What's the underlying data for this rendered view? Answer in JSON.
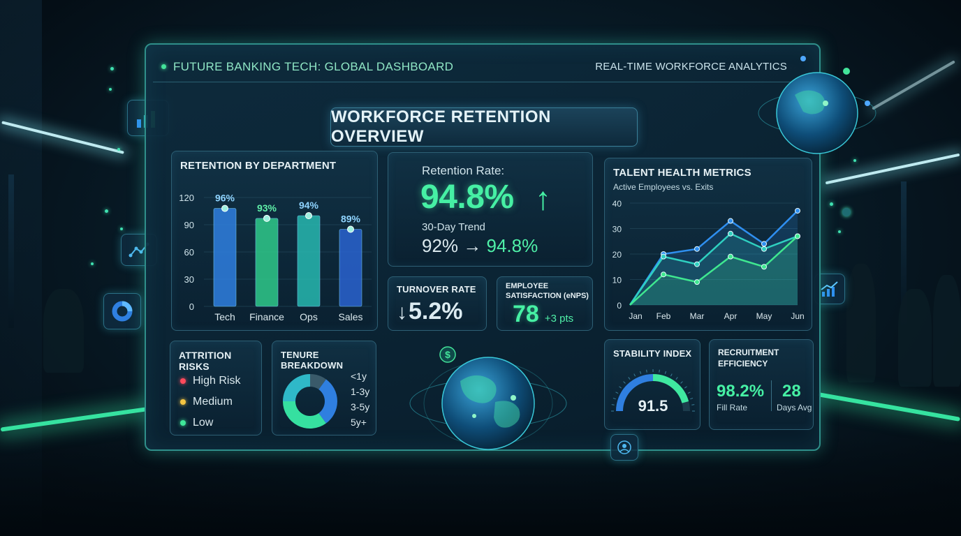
{
  "header": {
    "title": "FUTURE BANKING TECH: GLOBAL DASHBOARD",
    "subtitle": "REAL-TIME WORKFORCE ANALYTICS"
  },
  "main_title": "WORKFORCE RETENTION OVERVIEW",
  "retention_by_department": {
    "title": "RETENTION BY DEPARTMENT"
  },
  "retention_rate": {
    "label": "Retention Rate:",
    "value": "94.8%",
    "arrow": "↑",
    "trend_label": "30-Day Trend",
    "trend_from": "92%",
    "trend_arrow": "→",
    "trend_to": "94.8%"
  },
  "turnover": {
    "title": "TURNOVER RATE",
    "arrow": "↓",
    "value": "5.2%"
  },
  "satisfaction": {
    "title_line1": "EMPLOYEE",
    "title_line2": "SATISFACTION (eNPS)",
    "value": "78",
    "delta": "+3 pts"
  },
  "talent_health": {
    "title": "TALENT HEALTH METRICS",
    "subtitle": "Active Employees vs. Exits"
  },
  "attrition": {
    "title": "ATTRITION RISKS",
    "items": [
      {
        "label": "High Risk",
        "color": "#ff4a5c"
      },
      {
        "label": "Medium",
        "color": "#f5c542"
      },
      {
        "label": "Low",
        "color": "#3fe89a"
      }
    ]
  },
  "tenure": {
    "title": "TENURE BREAKDOWN",
    "labels": [
      "<1y",
      "1-3y",
      "3-5y",
      "5y+"
    ]
  },
  "stability": {
    "title": "STABILITY INDEX",
    "value": "91.5",
    "level": 0.915
  },
  "recruitment": {
    "title_line1": "RECRUITMENT",
    "title_line2": "EFFICIENCY",
    "fill_rate_value": "98.2%",
    "fill_rate_label": "Fill Rate",
    "days_value": "28",
    "days_label": "Days Avg"
  },
  "icons": [
    "bar-chart-icon",
    "line-graph-icon",
    "donut-chart-icon",
    "growth-chart-icon",
    "user-icon",
    "dollar-icon",
    "globe-icon"
  ],
  "chart_data": [
    {
      "type": "bar",
      "title": "RETENTION BY DEPARTMENT",
      "categories": [
        "Tech",
        "Finance",
        "Ops",
        "Sales"
      ],
      "values": [
        108,
        97,
        100,
        85
      ],
      "data_labels": [
        "96%",
        "93%",
        "94%",
        "89%"
      ],
      "yticks": [
        "0",
        "30",
        "60",
        "90",
        "120"
      ],
      "ylim": [
        0,
        120
      ],
      "colors": [
        "#2f7fe0",
        "#2fc98a",
        "#27b8b0",
        "#2a63d0"
      ]
    },
    {
      "type": "area",
      "title": "TALENT HEALTH METRICS",
      "subtitle": "Active Employees vs. Exits",
      "categories": [
        "Jan",
        "Feb",
        "Mar",
        "Apr",
        "May",
        "Jun"
      ],
      "yticks": [
        "0",
        "10",
        "20",
        "30",
        "40"
      ],
      "ylim": [
        0,
        40
      ],
      "series": [
        {
          "values": [
            0,
            20,
            22,
            33,
            24,
            37
          ],
          "color": "#2f8ff0"
        },
        {
          "values": [
            0,
            19,
            16,
            28,
            22,
            27
          ],
          "color": "#2fd0c0"
        },
        {
          "values": [
            0,
            12,
            9,
            19,
            15,
            27
          ],
          "color": "#3fe890"
        }
      ]
    },
    {
      "type": "pie",
      "title": "TENURE BREAKDOWN",
      "categories": [
        "<1y",
        "1-3y",
        "3-5y",
        "5y+"
      ],
      "values": [
        10,
        30,
        35,
        25
      ],
      "colors": [
        "#3a5a6a",
        "#2f7fe0",
        "#36e0a0",
        "#2fb8c8"
      ]
    }
  ]
}
